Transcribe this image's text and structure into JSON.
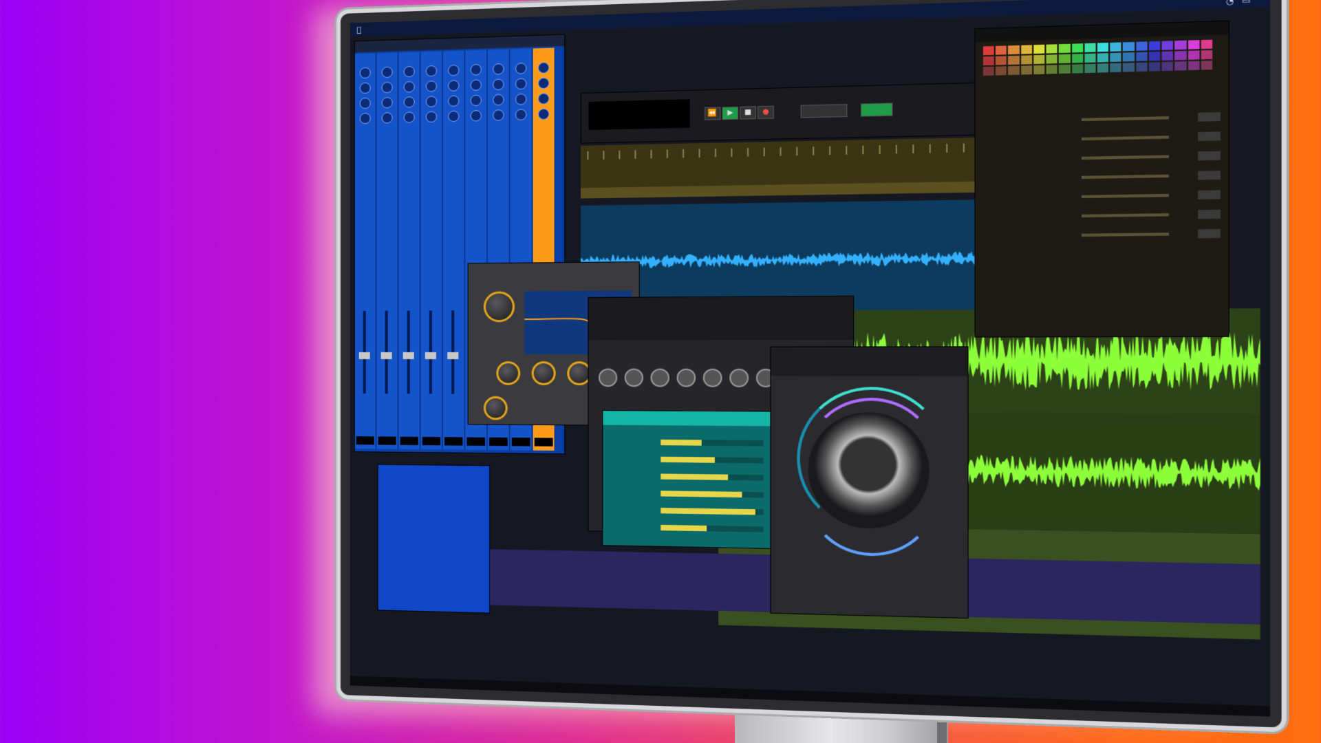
{
  "colors": {
    "background_left": "#9b00f5",
    "background_right": "#ff6e10",
    "mixer_blue": "#1554c8",
    "ruler_olive": "#3b3516",
    "waveform_blue": "#33b0ff",
    "waveform_green": "#8cff3a",
    "teal_plugin": "#14b5a5",
    "accent_orange": "#ff9b1a"
  },
  "menubar": {
    "items": [
      "",
      "",
      "",
      "",
      "",
      "",
      "",
      "",
      ""
    ]
  },
  "mixer": {
    "title": "",
    "channel_names": [
      "",
      "",
      "",
      "",
      "",
      "",
      "",
      "",
      ""
    ]
  },
  "transport": {
    "counter_main": "",
    "counter_sub": ""
  },
  "inspector": {
    "title": "",
    "rows": [
      {
        "label": "",
        "value": ""
      },
      {
        "label": "",
        "value": ""
      },
      {
        "label": "",
        "value": ""
      },
      {
        "label": "",
        "value": ""
      },
      {
        "label": "",
        "value": ""
      },
      {
        "label": "",
        "value": ""
      },
      {
        "label": "",
        "value": ""
      }
    ]
  },
  "plugins": {
    "teal_title": "",
    "round_title": ""
  },
  "icons": [
    "play-icon",
    "stop-icon",
    "record-icon",
    "apple-icon",
    "wifi-icon",
    "battery-icon"
  ]
}
